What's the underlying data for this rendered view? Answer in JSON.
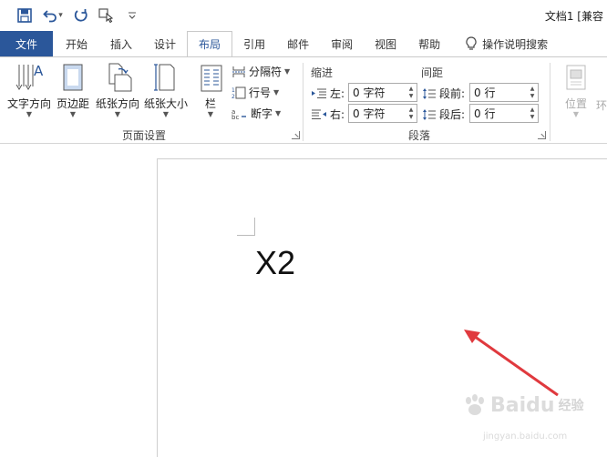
{
  "title_bar": {
    "doc_title": "文档1 [兼容"
  },
  "qat": {
    "icons": [
      "save-icon",
      "undo-icon",
      "redo-icon",
      "touch-mode-icon",
      "customize-icon"
    ],
    "undo_caret": "▾"
  },
  "tabs": [
    {
      "label": "文件"
    },
    {
      "label": "开始"
    },
    {
      "label": "插入"
    },
    {
      "label": "设计"
    },
    {
      "label": "布局"
    },
    {
      "label": "引用"
    },
    {
      "label": "邮件"
    },
    {
      "label": "审阅"
    },
    {
      "label": "视图"
    },
    {
      "label": "帮助"
    }
  ],
  "tell_me": "操作说明搜索",
  "page_setup": {
    "text_direction": "文字方向",
    "margins": "页边距",
    "orientation": "纸张方向",
    "size": "纸张大小",
    "columns": "栏",
    "breaks": "分隔符",
    "line_numbers": "行号",
    "hyphenation": "断字",
    "group_label": "页面设置"
  },
  "paragraph": {
    "indent_title": "缩进",
    "spacing_title": "间距",
    "left_label": "左:",
    "right_label": "右:",
    "before_label": "段前:",
    "after_label": "段后:",
    "left_value": "0 字符",
    "right_value": "0 字符",
    "before_value": "0 行",
    "after_value": "0 行",
    "group_label": "段落"
  },
  "arrange": {
    "position": "位置",
    "wrap_partial": "环"
  },
  "document": {
    "text": "X2"
  },
  "watermark": {
    "brand": "Baidu",
    "sub": "经验",
    "url": "jingyan.baidu.com"
  },
  "colors": {
    "accent": "#2b579a",
    "arrow": "#e0393e"
  }
}
